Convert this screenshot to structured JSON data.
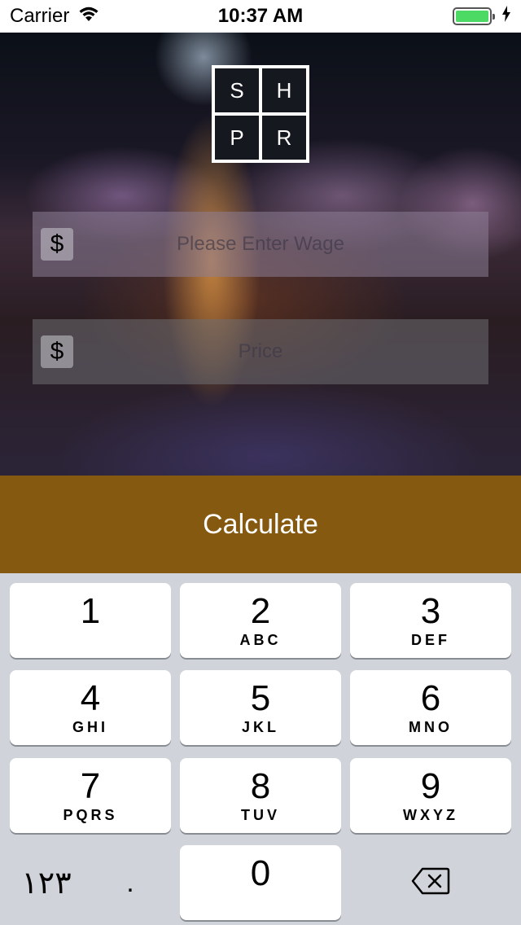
{
  "status_bar": {
    "carrier": "Carrier",
    "time": "10:37 AM",
    "wifi_icon": "wifi-icon",
    "battery_icon": "battery-icon",
    "charging_icon": "bolt-icon",
    "battery_level": 1.0
  },
  "logo": {
    "letters": [
      "S",
      "H",
      "P",
      "R"
    ]
  },
  "form": {
    "wage": {
      "currency_symbol": "$",
      "placeholder": "Please Enter Wage",
      "value": ""
    },
    "price": {
      "currency_symbol": "$",
      "placeholder": "Price",
      "value": ""
    }
  },
  "actions": {
    "calculate_label": "Calculate",
    "calculate_color": "#855910"
  },
  "keyboard": {
    "keys": [
      {
        "num": "1",
        "letters": ""
      },
      {
        "num": "2",
        "letters": "ABC"
      },
      {
        "num": "3",
        "letters": "DEF"
      },
      {
        "num": "4",
        "letters": "GHI"
      },
      {
        "num": "5",
        "letters": "JKL"
      },
      {
        "num": "6",
        "letters": "MNO"
      },
      {
        "num": "7",
        "letters": "PQRS"
      },
      {
        "num": "8",
        "letters": "TUV"
      },
      {
        "num": "9",
        "letters": "WXYZ"
      },
      {
        "num": "0",
        "letters": ""
      }
    ],
    "alt_digits_label": "١٢٣",
    "decimal_label": ".",
    "delete_icon": "backspace-icon"
  }
}
